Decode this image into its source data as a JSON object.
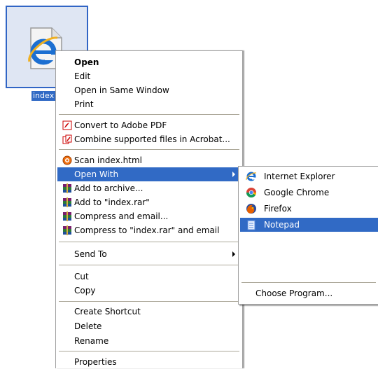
{
  "file": {
    "icon": "internet-explorer-html-file-icon",
    "label": "index"
  },
  "context_menu": {
    "open": "Open",
    "edit": "Edit",
    "open_same_window": "Open in Same Window",
    "print": "Print",
    "convert_pdf": "Convert to Adobe PDF",
    "combine_acrobat": "Combine supported files in Acrobat...",
    "scan": "Scan index.html",
    "open_with": "Open With",
    "add_archive": "Add to archive...",
    "add_rar": "Add to \"index.rar\"",
    "compress_email": "Compress and email...",
    "compress_rar_email": "Compress to \"index.rar\" and email",
    "send_to": "Send To",
    "cut": "Cut",
    "copy": "Copy",
    "create_shortcut": "Create Shortcut",
    "delete": "Delete",
    "rename": "Rename",
    "properties": "Properties"
  },
  "open_with_menu": {
    "internet_explorer": "Internet Explorer",
    "google_chrome": "Google Chrome",
    "firefox": "Firefox",
    "notepad": "Notepad",
    "choose_program": "Choose Program..."
  },
  "colors": {
    "highlight": "#316ac5",
    "separator": "#aca899"
  }
}
